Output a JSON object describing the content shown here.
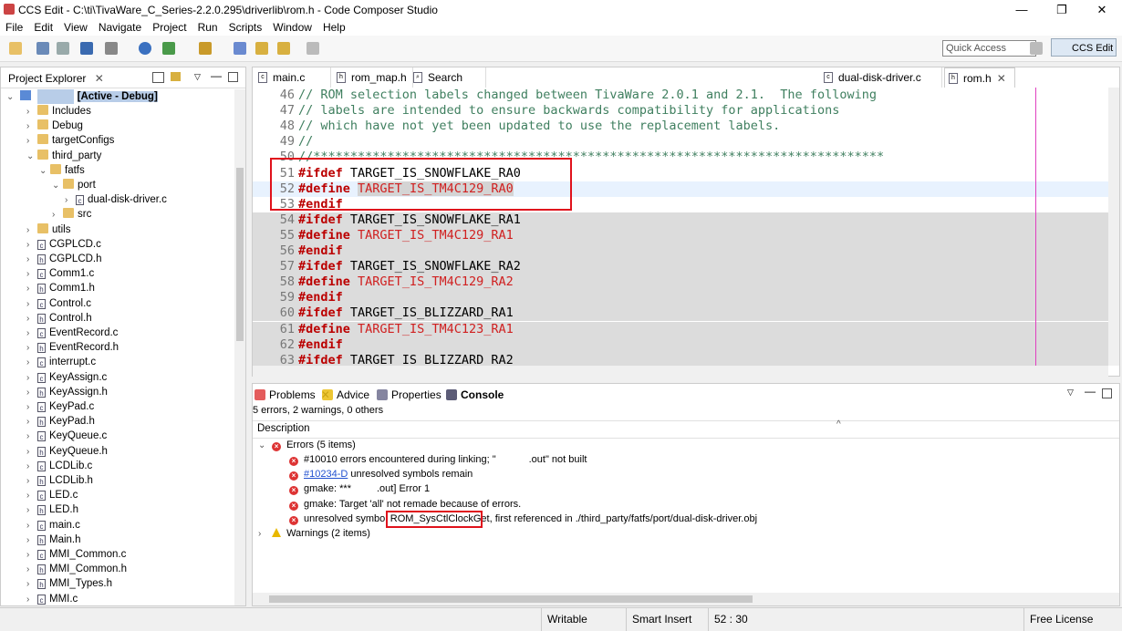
{
  "window": {
    "title": "CCS Edit - C:\\ti\\TivaWare_C_Series-2.2.0.295\\driverlib\\rom.h - Code Composer Studio",
    "minimize": "—",
    "maximize": "❐",
    "close": "✕"
  },
  "menu": [
    "File",
    "Edit",
    "View",
    "Navigate",
    "Project",
    "Run",
    "Scripts",
    "Window",
    "Help"
  ],
  "toolbar": {
    "quick_access_placeholder": "Quick Access",
    "perspective_label": "CCS Edit"
  },
  "project_explorer": {
    "tab_label": "Project Explorer",
    "close": "✕",
    "project_suffix": "[Active - Debug]",
    "items": [
      {
        "label": "Includes",
        "type": "folder",
        "indent": 1,
        "arrow": "›"
      },
      {
        "label": "Debug",
        "type": "folder",
        "indent": 1,
        "arrow": "›"
      },
      {
        "label": "targetConfigs",
        "type": "folder",
        "indent": 1,
        "arrow": "›"
      },
      {
        "label": "third_party",
        "type": "folder",
        "indent": 1,
        "arrow": "⌄"
      },
      {
        "label": "fatfs",
        "type": "folder",
        "indent": 2,
        "arrow": "⌄"
      },
      {
        "label": "port",
        "type": "folder",
        "indent": 3,
        "arrow": "⌄"
      },
      {
        "label": "dual-disk-driver.c",
        "type": "c",
        "indent": 4,
        "arrow": "›"
      },
      {
        "label": "src",
        "type": "folder",
        "indent": 3,
        "arrow": "›"
      },
      {
        "label": "utils",
        "type": "folder",
        "indent": 1,
        "arrow": "›"
      },
      {
        "label": "CGPLCD.c",
        "type": "c",
        "indent": 1,
        "arrow": "›"
      },
      {
        "label": "CGPLCD.h",
        "type": "h",
        "indent": 1,
        "arrow": "›"
      },
      {
        "label": "Comm1.c",
        "type": "c",
        "indent": 1,
        "arrow": "›"
      },
      {
        "label": "Comm1.h",
        "type": "h",
        "indent": 1,
        "arrow": "›"
      },
      {
        "label": "Control.c",
        "type": "c",
        "indent": 1,
        "arrow": "›"
      },
      {
        "label": "Control.h",
        "type": "h",
        "indent": 1,
        "arrow": "›"
      },
      {
        "label": "EventRecord.c",
        "type": "c",
        "indent": 1,
        "arrow": "›"
      },
      {
        "label": "EventRecord.h",
        "type": "h",
        "indent": 1,
        "arrow": "›"
      },
      {
        "label": "interrupt.c",
        "type": "c",
        "indent": 1,
        "arrow": "›"
      },
      {
        "label": "KeyAssign.c",
        "type": "c",
        "indent": 1,
        "arrow": "›"
      },
      {
        "label": "KeyAssign.h",
        "type": "h",
        "indent": 1,
        "arrow": "›"
      },
      {
        "label": "KeyPad.c",
        "type": "c",
        "indent": 1,
        "arrow": "›"
      },
      {
        "label": "KeyPad.h",
        "type": "h",
        "indent": 1,
        "arrow": "›"
      },
      {
        "label": "KeyQueue.c",
        "type": "c",
        "indent": 1,
        "arrow": "›"
      },
      {
        "label": "KeyQueue.h",
        "type": "h",
        "indent": 1,
        "arrow": "›"
      },
      {
        "label": "LCDLib.c",
        "type": "c",
        "indent": 1,
        "arrow": "›"
      },
      {
        "label": "LCDLib.h",
        "type": "h",
        "indent": 1,
        "arrow": "›"
      },
      {
        "label": "LED.c",
        "type": "c",
        "indent": 1,
        "arrow": "›"
      },
      {
        "label": "LED.h",
        "type": "h",
        "indent": 1,
        "arrow": "›"
      },
      {
        "label": "main.c",
        "type": "c",
        "indent": 1,
        "arrow": "›"
      },
      {
        "label": "Main.h",
        "type": "h",
        "indent": 1,
        "arrow": "›"
      },
      {
        "label": "MMI_Common.c",
        "type": "c",
        "indent": 1,
        "arrow": "›"
      },
      {
        "label": "MMI_Common.h",
        "type": "h",
        "indent": 1,
        "arrow": "›"
      },
      {
        "label": "MMI_Types.h",
        "type": "h",
        "indent": 1,
        "arrow": "›"
      },
      {
        "label": "MMI.c",
        "type": "c",
        "indent": 1,
        "arrow": "›"
      }
    ]
  },
  "editor": {
    "tabs": [
      {
        "label": "main.c",
        "icon": "c"
      },
      {
        "label": "rom_map.h",
        "icon": "h"
      },
      {
        "label": "Search",
        "icon": "s"
      },
      {
        "label": "dual-disk-driver.c",
        "icon": "c"
      },
      {
        "label": "rom.h",
        "icon": "h",
        "close": "✕"
      }
    ],
    "lines": [
      {
        "n": "46",
        "parts": [
          {
            "c": "cmt",
            "t": "// ROM selection labels changed between TivaWare 2.0.1 and 2.1.  The following"
          }
        ]
      },
      {
        "n": "47",
        "parts": [
          {
            "c": "cmt",
            "t": "// labels are intended to ensure backwards compatibility for applications"
          }
        ]
      },
      {
        "n": "48",
        "parts": [
          {
            "c": "cmt",
            "t": "// which have not yet been updated to use the replacement labels."
          }
        ]
      },
      {
        "n": "49",
        "parts": [
          {
            "c": "cmt",
            "t": "//"
          }
        ]
      },
      {
        "n": "50",
        "parts": [
          {
            "c": "cmt",
            "t": "//*****************************************************************************"
          }
        ]
      },
      {
        "n": "51",
        "parts": [
          {
            "c": "kw",
            "t": "#ifdef"
          },
          {
            "c": "",
            "t": " TARGET_IS_SNOWFLAKE_RA0"
          }
        ]
      },
      {
        "n": "52",
        "parts": [
          {
            "c": "kw",
            "t": "#define"
          },
          {
            "c": "",
            "t": " "
          },
          {
            "c": "red sel",
            "t": "TARGET_IS_TM4C129_RA0"
          }
        ]
      },
      {
        "n": "53",
        "parts": [
          {
            "c": "kw",
            "t": "#endif"
          }
        ]
      },
      {
        "n": "54",
        "parts": [
          {
            "c": "kw",
            "t": "#ifdef"
          },
          {
            "c": "",
            "t": " TARGET_IS_SNOWFLAKE_RA1"
          }
        ]
      },
      {
        "n": "55",
        "parts": [
          {
            "c": "kw",
            "t": "#define"
          },
          {
            "c": "",
            "t": " "
          },
          {
            "c": "red",
            "t": "TARGET_IS_TM4C129_RA1"
          }
        ]
      },
      {
        "n": "56",
        "parts": [
          {
            "c": "kw",
            "t": "#endif"
          }
        ]
      },
      {
        "n": "57",
        "parts": [
          {
            "c": "kw",
            "t": "#ifdef"
          },
          {
            "c": "",
            "t": " TARGET_IS_SNOWFLAKE_RA2"
          }
        ]
      },
      {
        "n": "58",
        "parts": [
          {
            "c": "kw",
            "t": "#define"
          },
          {
            "c": "",
            "t": " "
          },
          {
            "c": "red",
            "t": "TARGET_IS_TM4C129_RA2"
          }
        ]
      },
      {
        "n": "59",
        "parts": [
          {
            "c": "kw",
            "t": "#endif"
          }
        ]
      },
      {
        "n": "60",
        "parts": [
          {
            "c": "kw",
            "t": "#ifdef"
          },
          {
            "c": "",
            "t": " TARGET_IS_BLIZZARD_RA1"
          }
        ]
      },
      {
        "n": "61",
        "parts": [
          {
            "c": "kw",
            "t": "#define"
          },
          {
            "c": "",
            "t": " "
          },
          {
            "c": "red",
            "t": "TARGET_IS_TM4C123_RA1"
          }
        ]
      },
      {
        "n": "62",
        "parts": [
          {
            "c": "kw",
            "t": "#endif"
          }
        ]
      },
      {
        "n": "63",
        "parts": [
          {
            "c": "kw",
            "t": "#ifdef"
          },
          {
            "c": "",
            "t": " TARGET_IS_BLIZZARD_RA2"
          }
        ]
      }
    ]
  },
  "problems": {
    "tabs": [
      {
        "label": "Problems",
        "close": "✕"
      },
      {
        "label": "Advice"
      },
      {
        "label": "Properties"
      },
      {
        "label": "Console"
      }
    ],
    "summary": "5 errors, 2 warnings, 0 others",
    "column_header": "Description",
    "errors_group": "Errors (5 items)",
    "errors": [
      {
        "pre": "#10010 errors encountered during linking; \"",
        "post": ".out\" not built"
      },
      {
        "link": "#10234-D",
        "post": " unresolved symbols remain"
      },
      {
        "pre": "gmake: ***",
        "post": ".out] Error 1"
      },
      {
        "pre": "gmake: Target 'all' not remade because of errors."
      },
      {
        "pre": "unresolved symbol ",
        "highlight": "ROM_SysCtlClockGet",
        "post": ", first referenced in ./third_party/fatfs/port/dual-disk-driver.obj"
      }
    ],
    "warnings_group": "Warnings (2 items)"
  },
  "status": {
    "writable": "Writable",
    "insert_mode": "Smart Insert",
    "position": "52 : 30",
    "license": "Free License"
  },
  "colors": {
    "highlight_box": "#e0121c",
    "comment": "#3f7f5f",
    "directive": "#b00000",
    "macro": "#d02020"
  }
}
